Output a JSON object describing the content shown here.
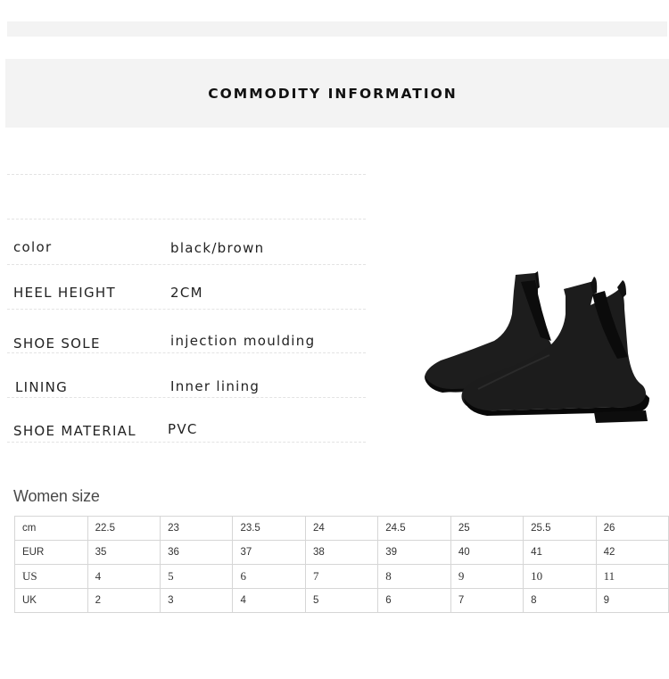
{
  "header": {
    "title": "COMMODITY INFORMATION"
  },
  "attributes": [
    {
      "label": "color",
      "value": "black/brown"
    },
    {
      "label": "HEEL HEIGHT",
      "value": "2CM"
    },
    {
      "label": "SHOE SOLE",
      "value": "injection moulding"
    },
    {
      "label": "LINING",
      "value": "Inner lining"
    },
    {
      "label": "SHOE MATERIAL",
      "value": "PVC"
    }
  ],
  "product_image": {
    "icon": "chelsea-rain-boots-image",
    "color": "#1a1a1a"
  },
  "size_chart": {
    "title": "Women size",
    "rows": [
      {
        "label": "cm",
        "values": [
          "22.5",
          "23",
          "23.5",
          "24",
          "24.5",
          "25",
          "25.5",
          "26"
        ]
      },
      {
        "label": "EUR",
        "values": [
          "35",
          "36",
          "37",
          "38",
          "39",
          "40",
          "41",
          "42"
        ]
      },
      {
        "label": "US",
        "values": [
          "4",
          "5",
          "6",
          "7",
          "8",
          "9",
          "10",
          "11"
        ]
      },
      {
        "label": "UK",
        "values": [
          "2",
          "3",
          "4",
          "5",
          "6",
          "7",
          "8",
          "9"
        ]
      }
    ]
  }
}
